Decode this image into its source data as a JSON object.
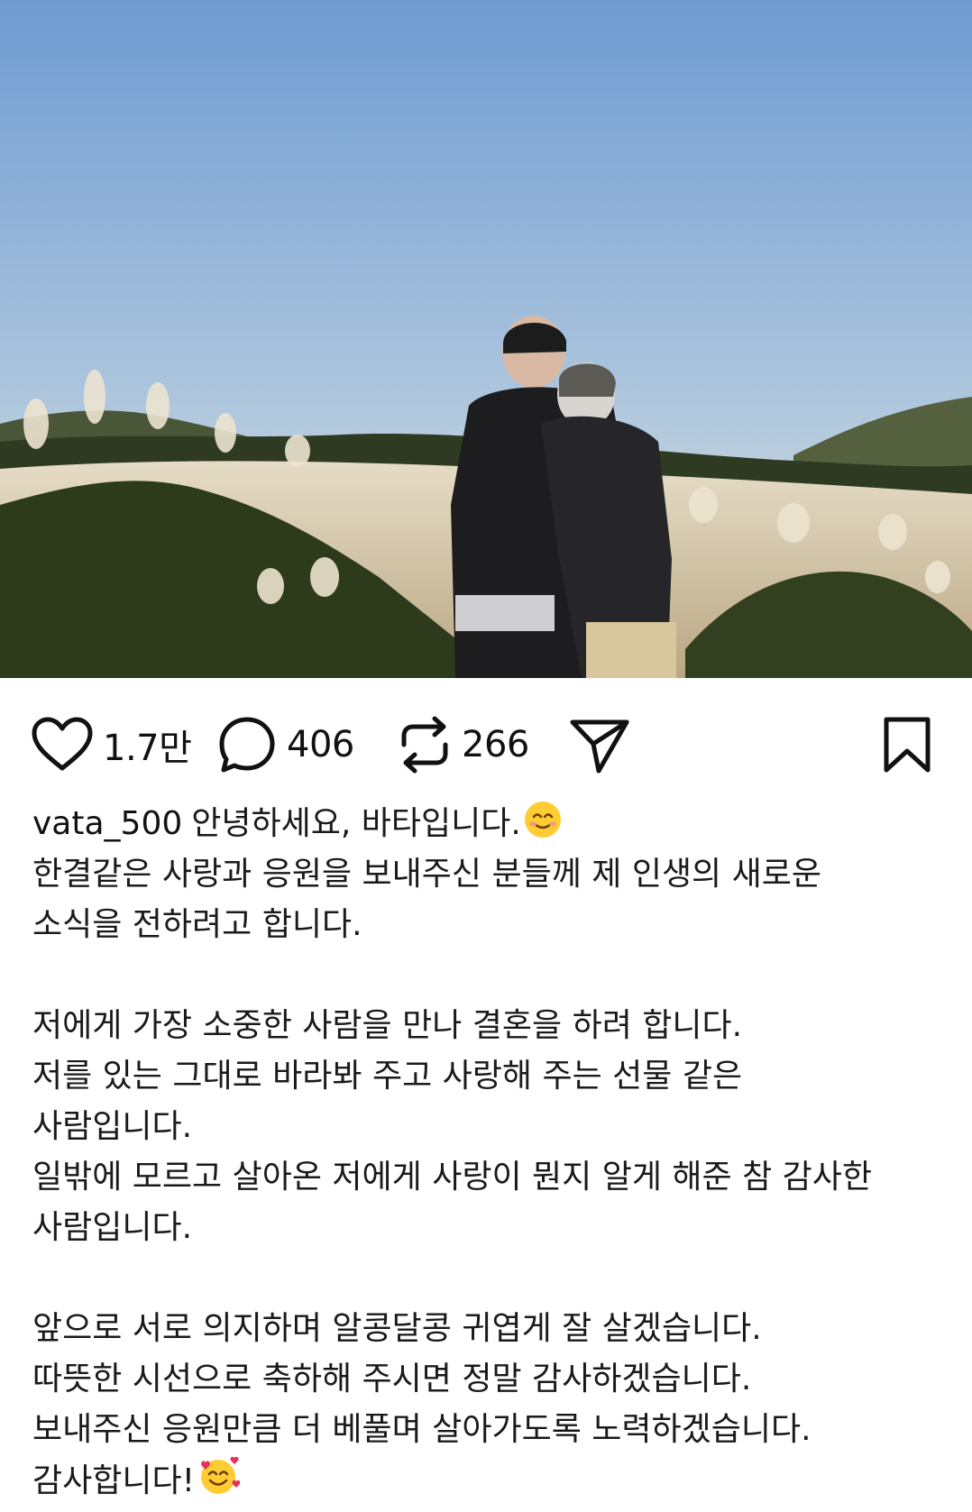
{
  "post": {
    "image_icon": "couple-photo",
    "colors": {
      "sky_top": "#7fa6d6",
      "sky_bottom": "#dfe6e2",
      "field": "#cdbfa3",
      "foliage": "#2f3b1e"
    }
  },
  "actions": {
    "like": {
      "icon": "heart-icon",
      "count": "1.7만"
    },
    "comment": {
      "icon": "comment-bubble-icon",
      "count": "406"
    },
    "repost": {
      "icon": "repost-icon",
      "count": "266"
    },
    "share": {
      "icon": "paper-plane-icon"
    },
    "save": {
      "icon": "bookmark-icon"
    }
  },
  "caption": {
    "username": "vata_500",
    "first_line_text": "안녕하세요, 바타입니다.",
    "first_line_emoji": "smiling-face-emoji",
    "lines": [
      "한결같은 사랑과 응원을 보내주신 분들께 제 인생의 새로운",
      "소식을 전하려고 합니다.",
      "",
      "저에게 가장 소중한 사람을 만나 결혼을 하려 합니다.",
      "저를 있는 그대로 바라봐 주고 사랑해 주는 선물 같은",
      "사람입니다.",
      "일밖에 모르고 살아온 저에게 사랑이 뭔지 알게 해준 참 감사한",
      "사람입니다.",
      "",
      "앞으로 서로 의지하며 알콩달콩 귀엽게 잘 살겠습니다.",
      "따뜻한 시선으로 축하해 주시면 정말 감사하겠습니다.",
      "보내주신 응원만큼 더 베풀며 살아가도록 노력하겠습니다."
    ],
    "last_line_text": "감사합니다!",
    "last_line_emoji": "smiling-face-with-hearts-emoji"
  }
}
